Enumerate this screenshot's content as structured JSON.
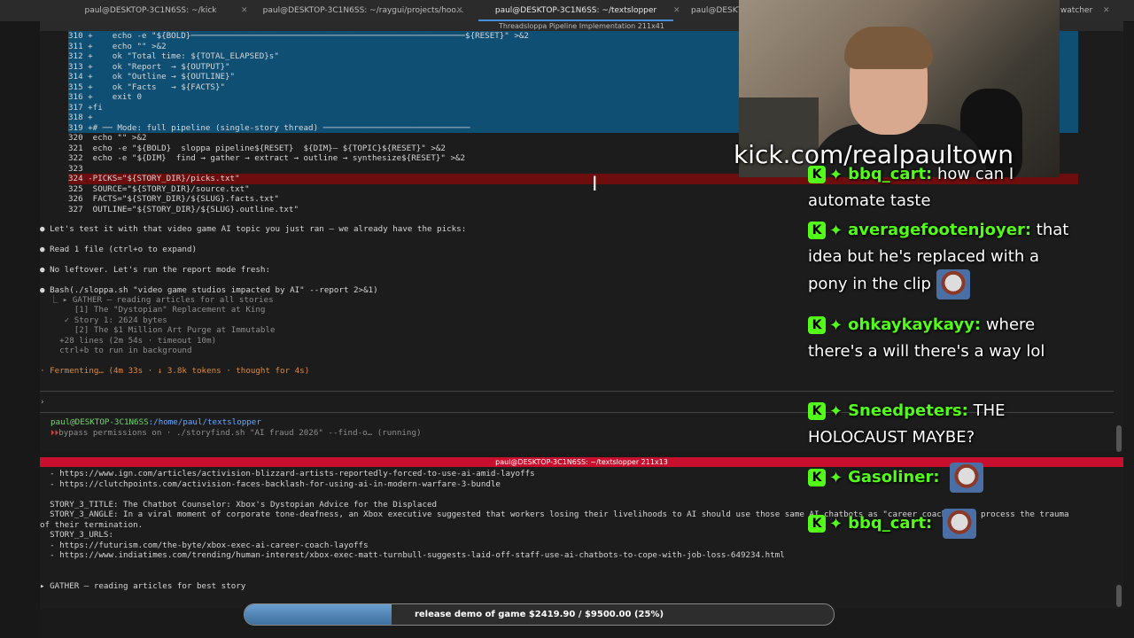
{
  "tabs": [
    {
      "label": "paul@DESKTOP-3C1N6SS: ~/kick",
      "active": false
    },
    {
      "label": "paul@DESKTOP-3C1N6SS: ~/raygui/projects/hoo...",
      "active": false
    },
    {
      "label": "paul@DESKTOP-3C1N6SS: ~/textslopper",
      "active": true
    },
    {
      "label": "paul@DESKTOP-3C1N6SS: ~/...",
      "active": false
    },
    {
      "label": "watcher",
      "active": false
    }
  ],
  "top_pane_title": "Threadsloppa Pipeline Implementation 211x41",
  "code_lines": [
    {
      "text": "310 +    echo -e \"${BOLD}────────────────────────────────────────────────────────${RESET}\" >&2",
      "style": "hl"
    },
    {
      "text": "311 +    echo \"\" >&2",
      "style": "hl"
    },
    {
      "text": "312 +    ok \"Total time: ${TOTAL_ELAPSED}s\"",
      "style": "hl"
    },
    {
      "text": "313 +    ok \"Report  → ${OUTPUT}\"",
      "style": "hl"
    },
    {
      "text": "314 +    ok \"Outline → ${OUTLINE}\"",
      "style": "hl"
    },
    {
      "text": "315 +    ok \"Facts   → ${FACTS}\"",
      "style": "hl"
    },
    {
      "text": "316 +    exit 0",
      "style": "hl"
    },
    {
      "text": "317 +fi",
      "style": "hl"
    },
    {
      "text": "318 +",
      "style": "hl"
    },
    {
      "text": "319 +# ── Mode: full pipeline (single-story thread) ──────────────────────────────",
      "style": "hl"
    },
    {
      "text": "320  echo \"\" >&2",
      "style": "plain"
    },
    {
      "text": "321  echo -e \"${BOLD}  sloppa pipeline${RESET}  ${DIM}— ${TOPIC}${RESET}\" >&2",
      "style": "plain"
    },
    {
      "text": "322  echo -e \"${DIM}  find → gather → extract → outline → synthesize${RESET}\" >&2",
      "style": "plain"
    },
    {
      "text": "323",
      "style": "plain"
    },
    {
      "text": "324 -PICKS=\"${STORY_DIR}/picks.txt\"",
      "style": "red"
    },
    {
      "text": "325  SOURCE=\"${STORY_DIR}/source.txt\"",
      "style": "plain"
    },
    {
      "text": "326  FACTS=\"${STORY_DIR}/${SLUG}.facts.txt\"",
      "style": "plain"
    },
    {
      "text": "327  OUTLINE=\"${STORY_DIR}/${SLUG}.outline.txt\"",
      "style": "plain"
    }
  ],
  "agent_lines": [
    {
      "text": "● Let's test it with that video game AI topic you just ran — we already have the picks:",
      "style": "bullet"
    },
    {
      "text": "● Read 1 file (ctrl+o to expand)",
      "style": "read"
    },
    {
      "text": "● No leftover. Let's run the report mode fresh:",
      "style": "bullet"
    },
    {
      "text": "● Bash(./sloppa.sh \"video game studios impacted by AI\" --report 2>&1)",
      "style": "bash"
    },
    {
      "text": "  ⎿ ▸ GATHER — reading articles for all stories",
      "style": "dim"
    },
    {
      "text": "       [1] The \"Dystopian\" Replacement at King",
      "style": "dim"
    },
    {
      "text": "     ✓ Story 1: 2624 bytes",
      "style": "dim"
    },
    {
      "text": "       [2] The $1 Million Art Purge at Immutable",
      "style": "dim"
    },
    {
      "text": "    +28 lines (2m 54s · timeout 10m)",
      "style": "dim"
    },
    {
      "text": "    ctrl+b to run in background",
      "style": "dim"
    },
    {
      "text": "· Fermenting… (4m 33s · ↓ 3.8k tokens · thought for 4s)",
      "style": "orange"
    }
  ],
  "prompt_symbol": "›",
  "prompt_path_user": "paul@DESKTOP-3C1N6SS",
  "prompt_path_dir": ":/home/paul/textslopper",
  "status_line": "bypass permissions on · ./storyfind.sh \"AI fraud 2026\" --find-o… (running)",
  "bottom_pane_title": "paul@DESKTOP-3C1N6SS: ~/textslopper 211x13",
  "bottom_lines": [
    "  - https://www.ign.com/articles/activision-blizzard-artists-reportedly-forced-to-use-ai-amid-layoffs",
    "  - https://clutchpoints.com/activision-faces-backlash-for-using-ai-in-modern-warfare-3-bundle",
    "",
    "  STORY_3_TITLE: The Chatbot Counselor: Xbox's Dystopian Advice for the Displaced",
    "  STORY_3_ANGLE: In a viral moment of corporate tone-deafness, an Xbox executive suggested that workers losing their livelihoods to AI should use those same AI chatbots as \"career coaches\" to process the trauma",
    "of their termination.",
    "  STORY_3_URLS:",
    "  - https://futurism.com/the-byte/xbox-exec-ai-career-coach-layoffs",
    "  - https://www.indiatimes.com/trending/human-interest/xbox-exec-matt-turnbull-suggests-laid-off-staff-use-ai-chatbots-to-cope-with-job-loss-649234.html",
    "",
    "",
    "▸ GATHER — reading articles for best story"
  ],
  "overlay": {
    "kick_url": "kick.com/realpaultown"
  },
  "chat": [
    {
      "user": "bbq_cart:",
      "text": "how can I automate taste"
    },
    {
      "user": "averagefootenjoyer:",
      "text": "that idea but he's replaced with a pony in the clip",
      "emote": true
    },
    {
      "user": "ohkaykaykayy:",
      "text": "where there's a will there's a way lol"
    },
    {
      "user": "Sneedpeters:",
      "text": "THE HOLOCAUST MAYBE?"
    },
    {
      "user": "Gasoliner:",
      "text": "",
      "emote": true
    },
    {
      "user": "bbq_cart:",
      "text": "",
      "emote": true
    }
  ],
  "goal": {
    "label": "release demo of game $2419.90 / $9500.00 (25%)",
    "fraction": 0.25,
    "color": "#5b8fc4"
  }
}
